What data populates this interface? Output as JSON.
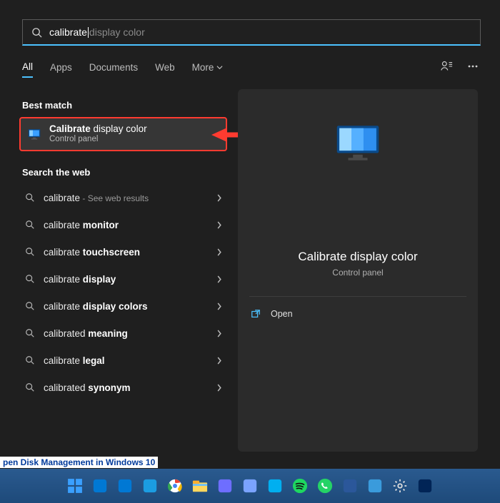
{
  "search": {
    "typed": "calibrate",
    "ghost": " display color"
  },
  "tabs": {
    "all": "All",
    "apps": "Apps",
    "documents": "Documents",
    "web": "Web",
    "more": "More"
  },
  "sections": {
    "best_match": "Best match",
    "search_web": "Search the web"
  },
  "best_match": {
    "title_bold": "Calibrate",
    "title_rest": " display color",
    "subtitle": "Control panel"
  },
  "web_results": [
    {
      "pre": "calibrate",
      "bold": "",
      "hint": " - See web results"
    },
    {
      "pre": "calibrate ",
      "bold": "monitor",
      "hint": ""
    },
    {
      "pre": "calibrate ",
      "bold": "touchscreen",
      "hint": ""
    },
    {
      "pre": "calibrate ",
      "bold": "display",
      "hint": ""
    },
    {
      "pre": "calibrate ",
      "bold": "display colors",
      "hint": ""
    },
    {
      "pre": "calibrated ",
      "bold": "meaning",
      "hint": ""
    },
    {
      "pre": "calibrate ",
      "bold": "legal",
      "hint": ""
    },
    {
      "pre": "calibrated ",
      "bold": "synonym",
      "hint": ""
    }
  ],
  "preview": {
    "title": "Calibrate display color",
    "subtitle": "Control panel",
    "open": "Open"
  },
  "link_strip": "pen Disk Management in Windows 10",
  "taskbar_icons": [
    "start",
    "outlook",
    "people",
    "edge",
    "chrome",
    "explorer",
    "snip",
    "notes",
    "skype",
    "spotify",
    "whatsapp",
    "word",
    "screen",
    "settings",
    "powershell"
  ]
}
